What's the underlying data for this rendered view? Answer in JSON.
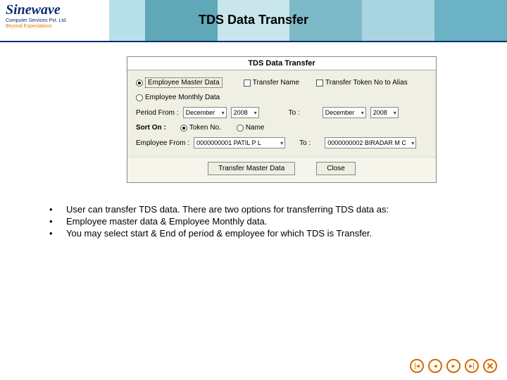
{
  "logo": {
    "name": "Sinewave",
    "sub": "Computer Services Pvt. Ltd.",
    "tag": "Beyond Expectations"
  },
  "header": {
    "title": "TDS Data Transfer"
  },
  "dialog": {
    "title": "TDS Data Transfer",
    "opt_master": "Employee Master Data",
    "opt_monthly": "Employee Monthly Data",
    "chk_name": "Transfer Name",
    "chk_alias": "Transfer Token No to Alias",
    "period_from_label": "Period From :",
    "period_to_label": "To :",
    "from_month": "December",
    "from_year": "2008",
    "to_month": "December",
    "to_year": "2008",
    "sort_label": "Sort On :",
    "sort_token": "Token No.",
    "sort_name": "Name",
    "emp_from_label": "Employee From :",
    "emp_to_label": "To :",
    "emp_from": "0000000001  PATIL  P L",
    "emp_to": "0000000002  BIRADAR M C",
    "btn_transfer": "Transfer Master Data",
    "btn_close": "Close"
  },
  "bullets": {
    "b1": "User can transfer TDS data. There are two options for transferring TDS data as:",
    "b2": "Employee master data & Employee Monthly data.",
    "b3": "You may select start & End of period & employee for which TDS is Transfer."
  }
}
